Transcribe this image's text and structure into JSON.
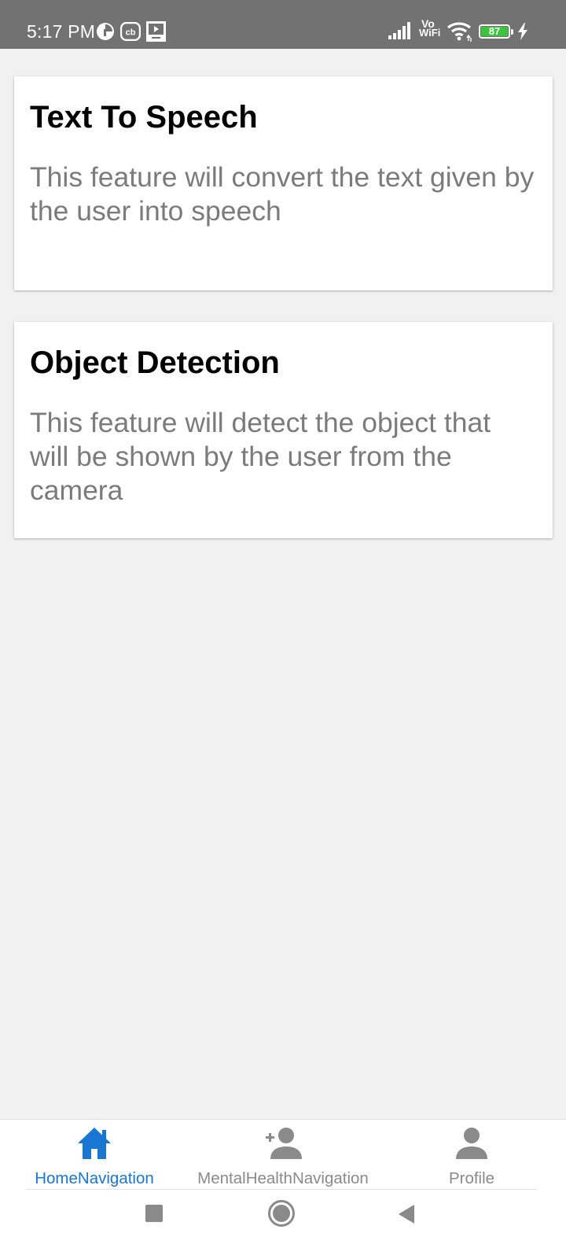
{
  "status_bar": {
    "time": "5:17 PM",
    "battery_level": "87",
    "network_label_top": "Vo",
    "network_label_bottom": "WiFi",
    "cb_badge": "cb",
    "icons": [
      "media-icon",
      "cb-icon",
      "screen-icon",
      "signal-icon",
      "vowifi-icon",
      "wifi-icon",
      "battery-icon",
      "charging-icon"
    ]
  },
  "cards": [
    {
      "title": "Text To Speech",
      "description": "This feature will convert the text given by the user into speech"
    },
    {
      "title": "Object Detection",
      "description": "This feature will detect the object that will be shown by the user from the camera"
    }
  ],
  "bottom_nav": {
    "active_color": "#1976d2",
    "inactive_color": "#8a8a8a",
    "items": [
      {
        "label": "HomeNavigation",
        "icon": "home-icon",
        "active": true
      },
      {
        "label": "MentalHealthNavigation",
        "icon": "add-person-icon",
        "active": false
      },
      {
        "label": "Profile",
        "icon": "person-icon",
        "active": false
      }
    ]
  },
  "system_nav": {
    "icons": [
      "recents-square-icon",
      "home-circle-icon",
      "back-triangle-icon"
    ]
  }
}
